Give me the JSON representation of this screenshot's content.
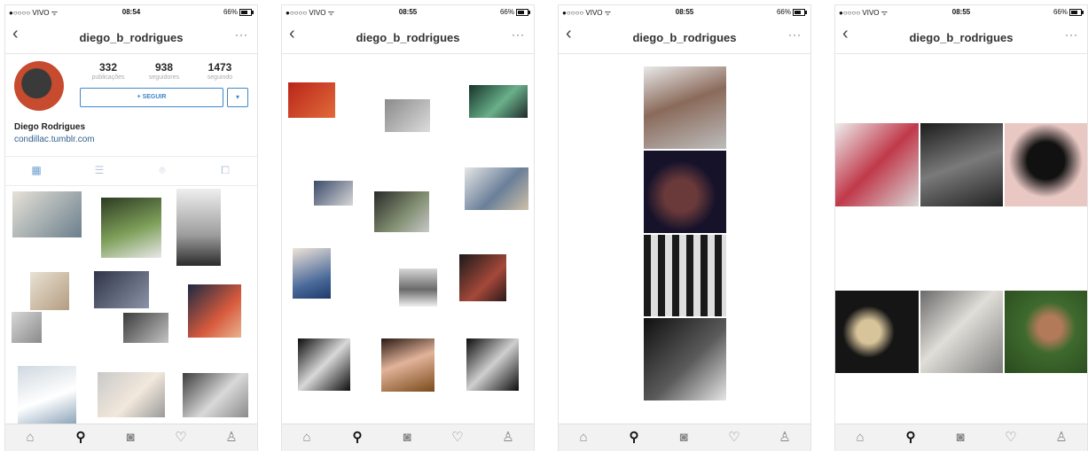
{
  "status": {
    "carrier": "●○○○○ VIVO ᯤ",
    "battery": "66%"
  },
  "screens": [
    {
      "time": "08:54",
      "title": "diego_b_rodrigues"
    },
    {
      "time": "08:55",
      "title": "diego_b_rodrigues"
    },
    {
      "time": "08:55",
      "title": "diego_b_rodrigues"
    },
    {
      "time": "08:55",
      "title": "diego_b_rodrigues"
    }
  ],
  "profile": {
    "stats": [
      {
        "value": "332",
        "label": "publicações"
      },
      {
        "value": "938",
        "label": "seguidores"
      },
      {
        "value": "1473",
        "label": "seguindo"
      }
    ],
    "follow_label": "+ SEGUIR",
    "dropdown_label": "▾",
    "name": "Diego Rodrigues",
    "website": "condillac.tumblr.com"
  },
  "icons": {
    "back": "‹",
    "more": "···",
    "grid": "▦",
    "list": "☰",
    "location": "⌾",
    "tagged": "⧠",
    "home": "⌂",
    "search": "⚲",
    "camera": "◙",
    "heart": "♡",
    "profile": "♙"
  },
  "colors": {
    "accent": "#3f87c6",
    "link": "#2f5f8f",
    "tabbar": "#f2f2f2"
  }
}
